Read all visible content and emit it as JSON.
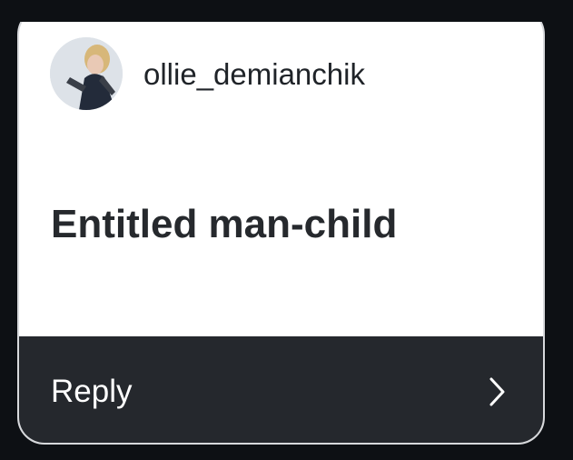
{
  "post": {
    "username": "ollie_demianchik",
    "avatar_icon": "user-avatar",
    "text": "Entitled man-child"
  },
  "reply": {
    "label": "Reply",
    "icon": "chevron-right-icon"
  }
}
